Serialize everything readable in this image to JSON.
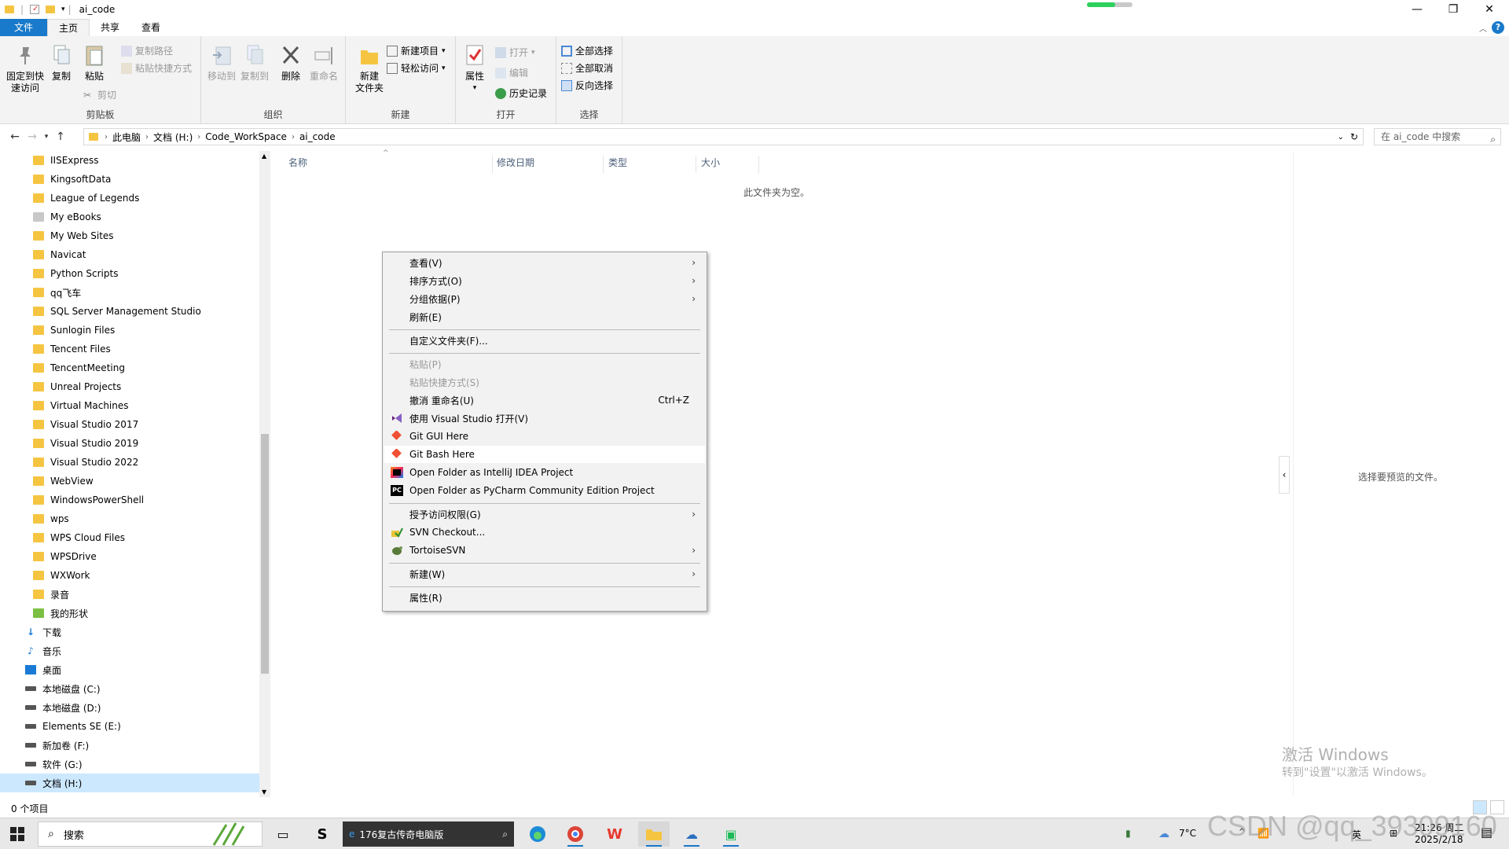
{
  "window": {
    "title": "ai_code",
    "minimize": "—",
    "maximize": "❐",
    "close": "✕"
  },
  "ribbon_tabs": [
    "文件",
    "主页",
    "共享",
    "查看"
  ],
  "ribbon": {
    "clipboard": {
      "label": "剪贴板",
      "pin": "固定到快\n速访问",
      "copy": "复制",
      "paste": "粘贴",
      "copy_path": "复制路径",
      "paste_shortcut": "粘贴快捷方式",
      "cut": "剪切"
    },
    "organize": {
      "label": "组织",
      "move_to": "移动到",
      "copy_to": "复制到",
      "delete": "删除",
      "rename": "重命名"
    },
    "new": {
      "label": "新建",
      "new_folder": "新建\n文件夹",
      "new_item": "新建项目",
      "easy_access": "轻松访问"
    },
    "open": {
      "label": "打开",
      "properties": "属性",
      "open": "打开",
      "edit": "编辑",
      "history": "历史记录"
    },
    "select": {
      "label": "选择",
      "select_all": "全部选择",
      "select_none": "全部取消",
      "invert": "反向选择"
    }
  },
  "breadcrumb": [
    "此电脑",
    "文档 (H:)",
    "Code_WorkSpace",
    "ai_code"
  ],
  "search_placeholder": "在 ai_code 中搜索",
  "nav_items": [
    "IISExpress",
    "KingsoftData",
    "League of Legends",
    "My eBooks",
    "My Web Sites",
    "Navicat",
    "Python Scripts",
    "qq飞车",
    "SQL Server Management Studio",
    "Sunlogin Files",
    "Tencent Files",
    "TencentMeeting",
    "Unreal Projects",
    "Virtual Machines",
    "Visual Studio 2017",
    "Visual Studio 2019",
    "Visual Studio 2022",
    "WebView",
    "WindowsPowerShell",
    "wps",
    "WPS Cloud Files",
    "WPSDrive",
    "WXWork",
    "录音",
    "我的形状",
    "下载",
    "音乐",
    "桌面",
    "本地磁盘 (C:)",
    "本地磁盘 (D:)",
    "Elements SE (E:)",
    "新加卷 (F:)",
    "软件 (G:)",
    "文档 (H:)"
  ],
  "columns": [
    "名称",
    "修改日期",
    "类型",
    "大小"
  ],
  "empty_message": "此文件夹为空。",
  "context_menu": {
    "view": "查看(V)",
    "sort": "排序方式(O)",
    "group": "分组依据(P)",
    "refresh": "刷新(E)",
    "customize": "自定义文件夹(F)...",
    "paste": "粘贴(P)",
    "paste_shortcut": "粘贴快捷方式(S)",
    "undo": "撤消 重命名(U)",
    "undo_shortcut": "Ctrl+Z",
    "open_vs": "使用 Visual Studio 打开(V)",
    "git_gui": "Git GUI Here",
    "git_bash": "Git Bash Here",
    "intellij": "Open Folder as IntelliJ IDEA Project",
    "pycharm": "Open Folder as PyCharm Community Edition Project",
    "grant_access": "授予访问权限(G)",
    "svn_checkout": "SVN Checkout...",
    "tortoise": "TortoiseSVN",
    "new": "新建(W)",
    "properties": "属性(R)"
  },
  "preview_message": "选择要预览的文件。",
  "status": "0 个项目",
  "watermark": {
    "line1": "激活 Windows",
    "line2": "转到\"设置\"以激活 Windows。",
    "csdn": "CSDN @qq_39309160"
  },
  "taskbar": {
    "search": "搜索",
    "media": "176复古传奇电脑版",
    "weather": "7°C",
    "ime": "英",
    "time": "21:26 周二",
    "date": "2025/2/18"
  },
  "colors": {
    "accent": "#1979ca",
    "folder": "#f5c542",
    "selected": "#cce8ff"
  }
}
